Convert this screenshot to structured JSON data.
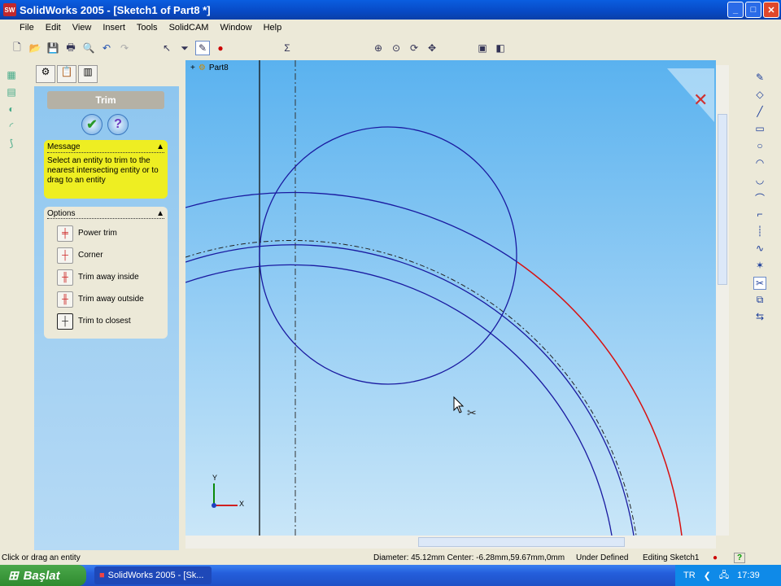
{
  "window": {
    "title": "SolidWorks 2005 - [Sketch1 of Part8 *]",
    "logo": "SW"
  },
  "menu": [
    "File",
    "Edit",
    "View",
    "Insert",
    "Tools",
    "SolidCAM",
    "Window",
    "Help"
  ],
  "tree": {
    "root": "Part8"
  },
  "property_manager": {
    "title": "Trim",
    "message": {
      "header": "Message",
      "text": "Select an entity to trim to the nearest intersecting entity or to drag to an entity"
    },
    "options": {
      "header": "Options",
      "items": [
        "Power trim",
        "Corner",
        "Trim away inside",
        "Trim away outside",
        "Trim to closest"
      ]
    }
  },
  "triad": {
    "x": "X",
    "y": "Y"
  },
  "status": {
    "hint": "Click or drag an entity",
    "measure": "Diameter: 45.12mm  Center: -6.28mm,59.67mm,0mm",
    "state": "Under Defined",
    "mode": "Editing Sketch1"
  },
  "taskbar": {
    "start": "Başlat",
    "task": "SolidWorks 2005 - [Sk...",
    "lang": "TR",
    "clock": "17:39"
  },
  "colors": {
    "sketch": "#1a1aa0",
    "selected": "#d81010",
    "titlebar": "#0a5ee0"
  }
}
